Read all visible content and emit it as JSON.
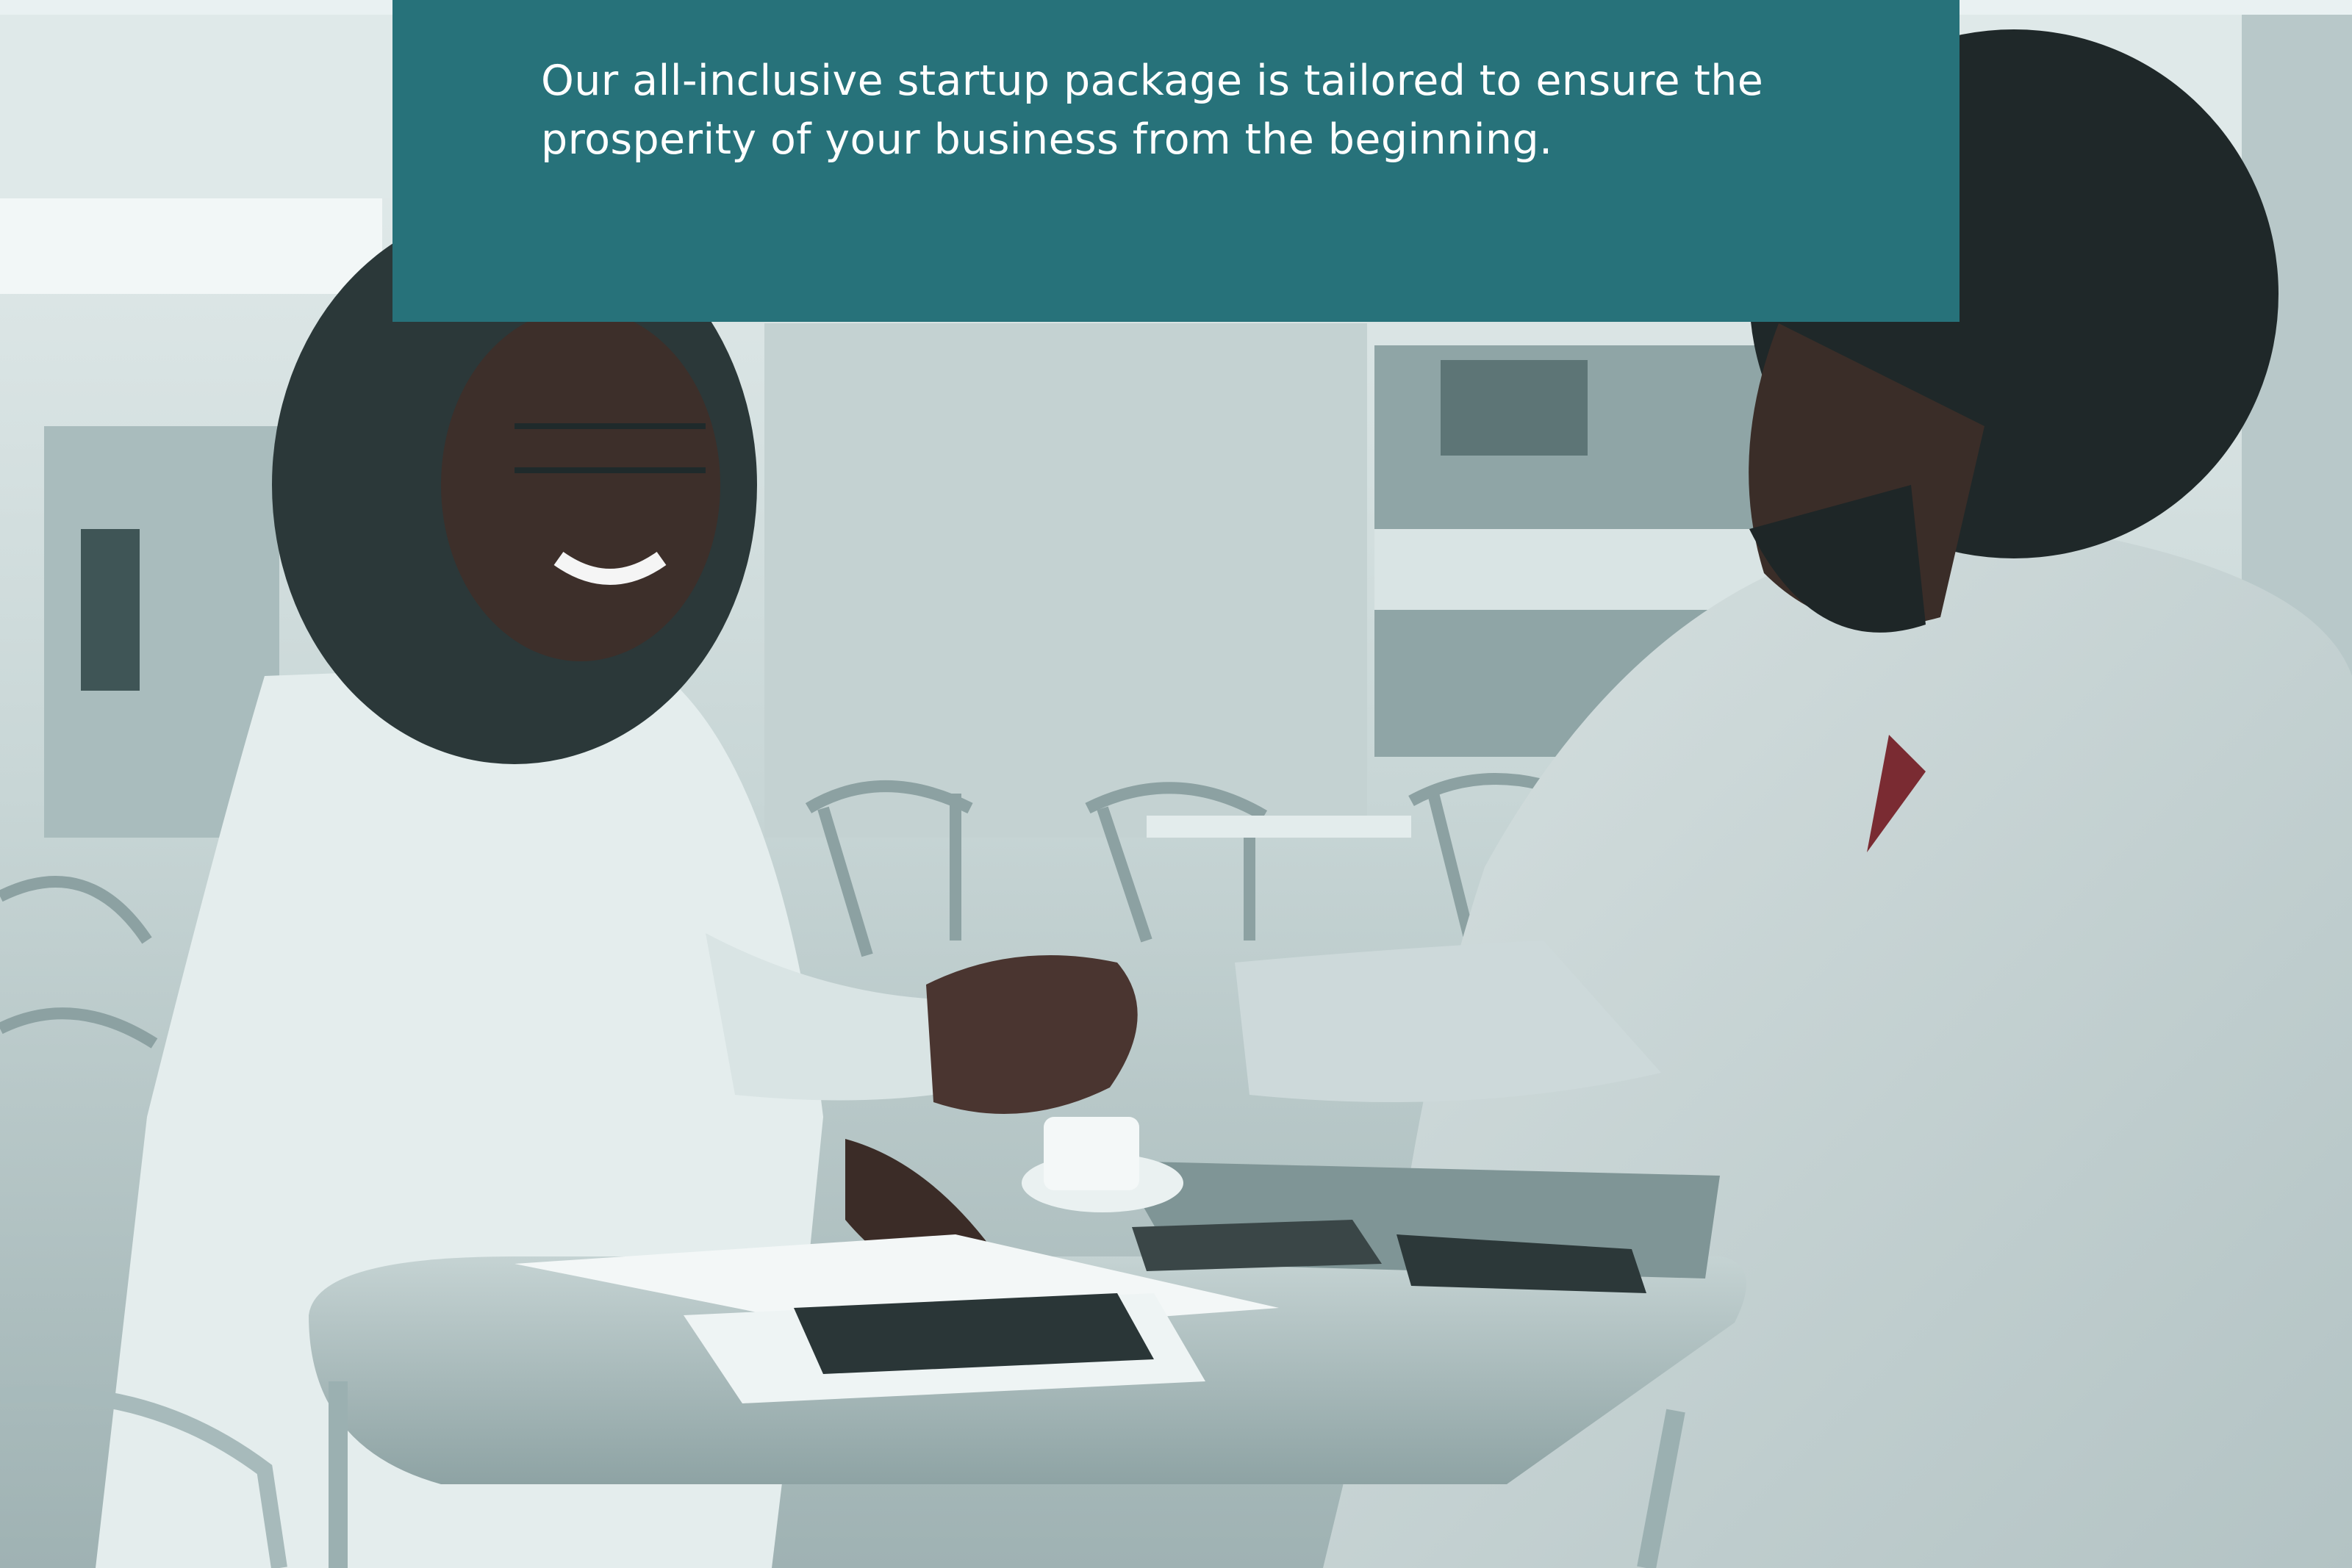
{
  "banner": {
    "text": "Our all-inclusive startup package is tailored to ensure the prosperity of your business from the beginning.",
    "background_color": "#27727a",
    "text_color": "#ffffff"
  },
  "photo": {
    "tint": "teal-duotone",
    "subject": "handshake-at-cafe-table"
  }
}
